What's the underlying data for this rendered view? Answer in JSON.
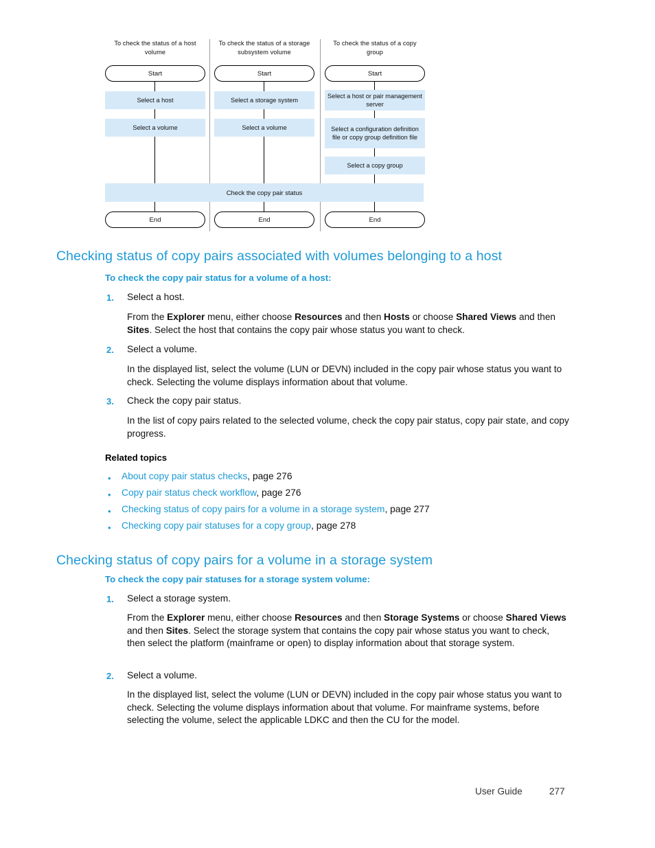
{
  "flowchart": {
    "columns": [
      {
        "caption": "To check the status of a host volume",
        "start": "Start",
        "steps": [
          "Select a host",
          "Select a volume"
        ],
        "end": "End"
      },
      {
        "caption": "To check the status of a storage subsystem volume",
        "start": "Start",
        "steps": [
          "Select a storage system",
          "Select a volume"
        ],
        "end": "End"
      },
      {
        "caption": "To check the status of a copy group",
        "start": "Start",
        "steps": [
          "Select a host or pair management server",
          "Select a configuration definition file or copy group definition file",
          "Select a copy group"
        ],
        "end": "End"
      }
    ],
    "shared_step": "Check the copy pair status",
    "box_color": "#d6e9f8"
  },
  "section1": {
    "heading": "Checking status of copy pairs associated with volumes belonging to a host",
    "subheading": "To check the copy pair status for a volume of a host:",
    "steps": [
      {
        "num": "1.",
        "title": "Select a host.",
        "body_html": "From the <b>Explorer</b> menu, either choose <b>Resources</b> and then <b>Hosts</b> or choose <b>Shared Views</b> and then <b>Sites</b>. Select the host that contains the copy pair whose status you want to check."
      },
      {
        "num": "2.",
        "title": "Select a volume.",
        "body_html": "In the displayed list, select the volume (LUN or DEVN) included in the copy pair whose status you want to check. Selecting the volume displays information about that volume."
      },
      {
        "num": "3.",
        "title": "Check the copy pair status.",
        "body_html": "In the list of copy pairs related to the selected volume, check the copy pair status, copy pair state, and copy progress."
      }
    ],
    "related_topics_label": "Related topics",
    "related_topics": [
      {
        "bullet": "•",
        "link": "About copy pair status checks",
        "page_ref": ", page 276"
      },
      {
        "bullet": "•",
        "link": "Copy pair status check workflow",
        "page_ref": ", page 276"
      },
      {
        "bullet": "•",
        "link": "Checking status of copy pairs for a volume in a storage system",
        "page_ref": ", page 277"
      },
      {
        "bullet": "•",
        "link": "Checking copy pair statuses for a copy group",
        "page_ref": ", page 278"
      }
    ]
  },
  "section2": {
    "heading": "Checking status of copy pairs for a volume in a storage system",
    "subheading": "To check the copy pair statuses for a storage system volume:",
    "steps": [
      {
        "num": "1.",
        "title": "Select a storage system.",
        "body_html": "From the <b>Explorer</b> menu, either choose <b>Resources</b> and then <b>Storage Systems</b> or choose <b>Shared Views</b> and then <b>Sites</b>. Select the storage system that contains the copy pair whose status you want to check, then select the platform (mainframe or open) to display information about that storage system."
      },
      {
        "num": "2.",
        "title": "Select a volume.",
        "body_html": "In the displayed list, select the volume (LUN or DEVN) included in the copy pair whose status you want to check. Selecting the volume displays information about that volume. For mainframe systems, before selecting the volume, select the applicable LDKC and then the CU for the model."
      }
    ]
  },
  "footer": {
    "label": "User Guide",
    "page": "277"
  },
  "colors": {
    "heading_blue": "#1e9ad6",
    "box_fill": "#d6e9f8"
  }
}
